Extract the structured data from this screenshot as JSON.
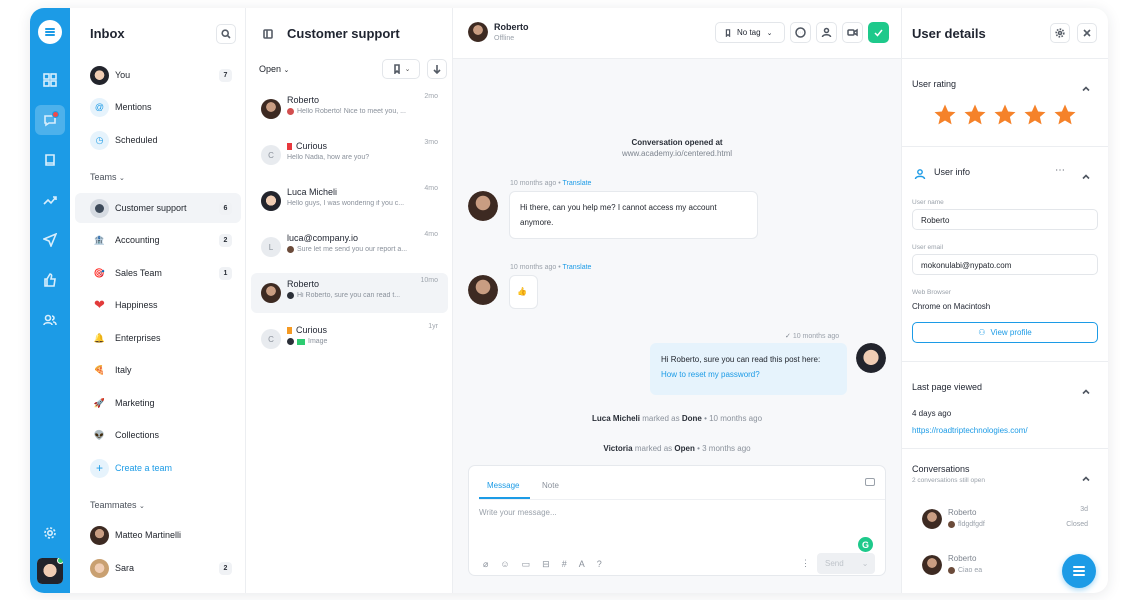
{
  "inbox": {
    "title": "Inbox",
    "items": [
      {
        "label": "You",
        "count": "7"
      },
      {
        "label": "Mentions",
        "count": ""
      },
      {
        "label": "Scheduled",
        "count": ""
      }
    ],
    "teams_heading": "Teams",
    "teams": [
      {
        "label": "Customer support",
        "count": "6",
        "emoji": "●"
      },
      {
        "label": "Accounting",
        "count": "2",
        "emoji": "🏦"
      },
      {
        "label": "Sales Team",
        "count": "1",
        "emoji": "🎯"
      },
      {
        "label": "Happiness",
        "count": "",
        "emoji": "❤"
      },
      {
        "label": "Enterprises",
        "count": "",
        "emoji": "🔔"
      },
      {
        "label": "Italy",
        "count": "",
        "emoji": "🍕"
      },
      {
        "label": "Marketing",
        "count": "",
        "emoji": "🚀"
      },
      {
        "label": "Collections",
        "count": "",
        "emoji": "👽"
      }
    ],
    "create_team": "Create a team",
    "teammates_heading": "Teammates",
    "teammates": [
      {
        "label": "Matteo Martinelli",
        "count": ""
      },
      {
        "label": "Sara",
        "count": "2"
      }
    ]
  },
  "convlist": {
    "title": "Customer support",
    "filter": "Open",
    "conversations": [
      {
        "name": "Roberto",
        "preview": "Hello Roberto! Nice to meet you, ...",
        "time": "2mo",
        "initial": ""
      },
      {
        "name": "Curious",
        "preview": "Hello Nadia, how are you?",
        "time": "3mo",
        "initial": "C"
      },
      {
        "name": "Luca Micheli",
        "preview": "Hello guys, I was wondering if you c...",
        "time": "4mo",
        "initial": ""
      },
      {
        "name": "luca@company.io",
        "preview": "Sure let me send you our report a...",
        "time": "4mo",
        "initial": "L"
      },
      {
        "name": "Roberto",
        "preview": "Hi Roberto, sure you can read t...",
        "time": "10mo",
        "initial": ""
      },
      {
        "name": "Curious",
        "preview": "Image",
        "time": "1yr",
        "initial": "C"
      }
    ]
  },
  "chat": {
    "contact_name": "Roberto",
    "contact_status": "Offline",
    "tag_label": "No tag",
    "opened_title": "Conversation opened at",
    "opened_url": "www.academy.io/centered.html",
    "msg1_time": "10 months ago",
    "translate": "Translate",
    "msg1_text": "Hi there, can you help me? I cannot access my account anymore.",
    "msg2_time": "10 months ago",
    "msg2_text": "👍",
    "msg3_time": "10 months ago",
    "msg3_text": "Hi Roberto, sure you can read this post here:",
    "msg3_link": "How to reset my password?",
    "sys1_name": "Luca Micheli",
    "sys1_mid": "marked as",
    "sys1_status": "Done",
    "sys1_time": "• 10 months ago",
    "sys2_name": "Victoria",
    "sys2_mid": "marked as",
    "sys2_status": "Open",
    "sys2_time": "• 3 months ago",
    "composer_tab_message": "Message",
    "composer_tab_note": "Note",
    "composer_placeholder": "Write your message...",
    "send_label": "Send",
    "accent": "#1c9be6",
    "success": "#1ec98b"
  },
  "details": {
    "title": "User details",
    "rating_title": "User rating",
    "rating_value": 5,
    "rating_max": 5,
    "info_title": "User info",
    "name_label": "User name",
    "name_value": "Roberto",
    "email_label": "User email",
    "email_value": "mokonulabi@nypato.com",
    "browser_label": "Web Browser",
    "browser_value": "Chrome on Macintosh",
    "view_profile": "View profile",
    "last_page_title": "Last page viewed",
    "last_page_time": "4 days ago",
    "last_page_url": "https://roadtriptechnologies.com/",
    "conv_title": "Conversations",
    "conv_sub": "2 conversations still open",
    "conversations": [
      {
        "name": "Roberto",
        "preview": "fldgdfgdf",
        "time": "3d",
        "status": "Closed"
      },
      {
        "name": "Roberto",
        "preview": "Ciao ea",
        "time": "",
        "status": ""
      }
    ]
  }
}
